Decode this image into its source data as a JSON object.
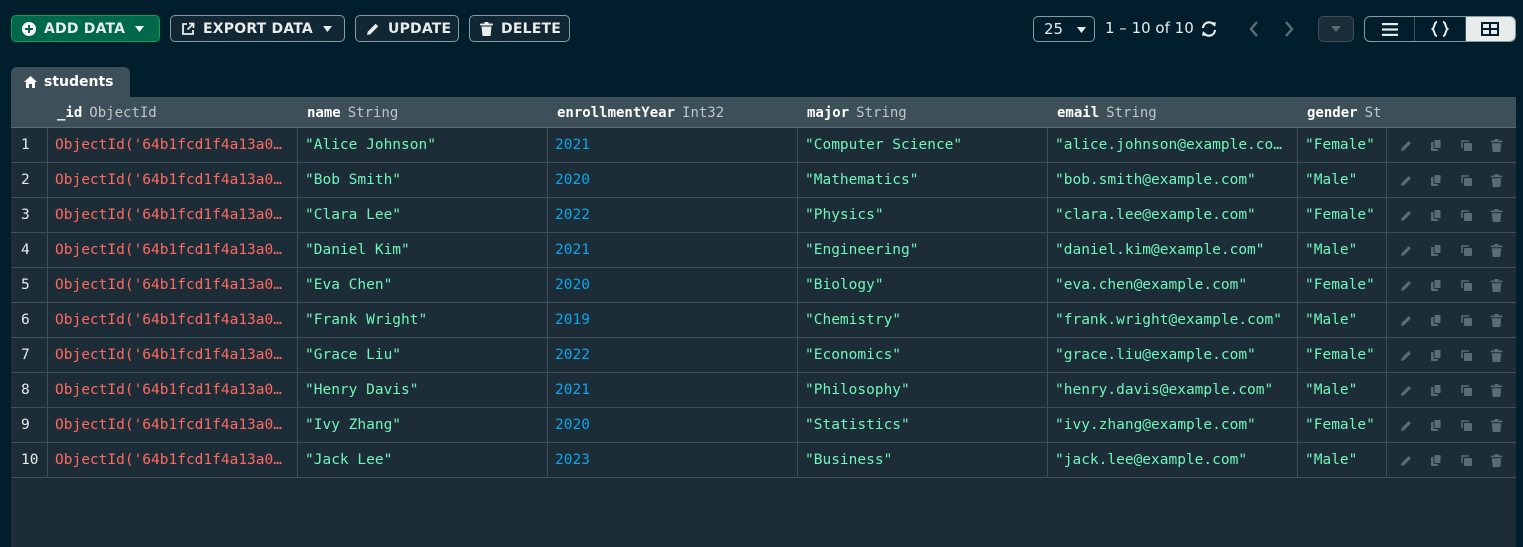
{
  "toolbar": {
    "add_label": "ADD DATA",
    "export_label": "EXPORT DATA",
    "update_label": "UPDATE",
    "delete_label": "DELETE",
    "page_size": "25",
    "range_text": "1 – 10 of 10"
  },
  "tab": {
    "label": "students"
  },
  "columns": [
    {
      "name": "_id",
      "type": "ObjectId"
    },
    {
      "name": "name",
      "type": "String"
    },
    {
      "name": "enrollmentYear",
      "type": "Int32"
    },
    {
      "name": "major",
      "type": "String"
    },
    {
      "name": "email",
      "type": "String"
    },
    {
      "name": "gender",
      "type": "St"
    }
  ],
  "rows": [
    {
      "idx": "1",
      "id": "ObjectId('64b1fcd1f4a13a0…",
      "name": "\"Alice Johnson\"",
      "year": "2021",
      "major": "\"Computer Science\"",
      "email": "\"alice.johnson@example.co…",
      "gender": "\"Female\""
    },
    {
      "idx": "2",
      "id": "ObjectId('64b1fcd1f4a13a0…",
      "name": "\"Bob Smith\"",
      "year": "2020",
      "major": "\"Mathematics\"",
      "email": "\"bob.smith@example.com\"",
      "gender": "\"Male\""
    },
    {
      "idx": "3",
      "id": "ObjectId('64b1fcd1f4a13a0…",
      "name": "\"Clara Lee\"",
      "year": "2022",
      "major": "\"Physics\"",
      "email": "\"clara.lee@example.com\"",
      "gender": "\"Female\""
    },
    {
      "idx": "4",
      "id": "ObjectId('64b1fcd1f4a13a0…",
      "name": "\"Daniel Kim\"",
      "year": "2021",
      "major": "\"Engineering\"",
      "email": "\"daniel.kim@example.com\"",
      "gender": "\"Male\""
    },
    {
      "idx": "5",
      "id": "ObjectId('64b1fcd1f4a13a0…",
      "name": "\"Eva Chen\"",
      "year": "2020",
      "major": "\"Biology\"",
      "email": "\"eva.chen@example.com\"",
      "gender": "\"Female\""
    },
    {
      "idx": "6",
      "id": "ObjectId('64b1fcd1f4a13a0…",
      "name": "\"Frank Wright\"",
      "year": "2019",
      "major": "\"Chemistry\"",
      "email": "\"frank.wright@example.com\"",
      "gender": "\"Male\""
    },
    {
      "idx": "7",
      "id": "ObjectId('64b1fcd1f4a13a0…",
      "name": "\"Grace Liu\"",
      "year": "2022",
      "major": "\"Economics\"",
      "email": "\"grace.liu@example.com\"",
      "gender": "\"Female\""
    },
    {
      "idx": "8",
      "id": "ObjectId('64b1fcd1f4a13a0…",
      "name": "\"Henry Davis\"",
      "year": "2021",
      "major": "\"Philosophy\"",
      "email": "\"henry.davis@example.com\"",
      "gender": "\"Male\""
    },
    {
      "idx": "9",
      "id": "ObjectId('64b1fcd1f4a13a0…",
      "name": "\"Ivy Zhang\"",
      "year": "2020",
      "major": "\"Statistics\"",
      "email": "\"ivy.zhang@example.com\"",
      "gender": "\"Female\""
    },
    {
      "idx": "10",
      "id": "ObjectId('64b1fcd1f4a13a0…",
      "name": "\"Jack Lee\"",
      "year": "2023",
      "major": "\"Business\"",
      "email": "\"jack.lee@example.com\"",
      "gender": "\"Male\""
    }
  ],
  "icons": {
    "toolbar": [
      "plus-circle-icon",
      "export-icon",
      "pencil-icon",
      "trash-icon",
      "refresh-icon",
      "chevron-left-icon",
      "chevron-right-icon",
      "caret-down-icon",
      "list-view-icon",
      "json-view-icon",
      "table-view-icon"
    ],
    "tab": "home-icon",
    "row_actions": [
      "edit-icon",
      "copy-icon",
      "clone-icon",
      "delete-icon"
    ]
  },
  "colors": {
    "background": "#001e2b",
    "add_button": "#00684a",
    "objectid": "#ff6960",
    "string": "#71f6ba",
    "number": "#0ea5e9"
  }
}
